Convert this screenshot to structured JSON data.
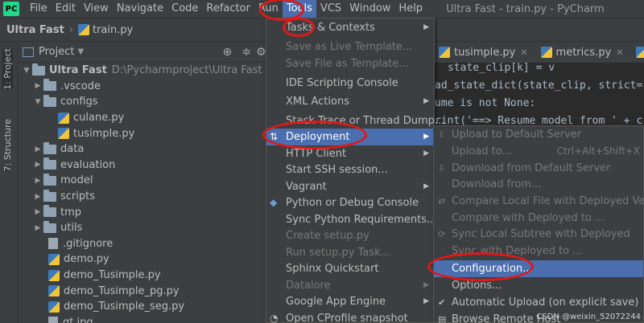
{
  "menubar": {
    "logo": "PC",
    "items": [
      "File",
      "Edit",
      "View",
      "Navigate",
      "Code",
      "Refactor",
      "Run",
      "Tools",
      "VCS",
      "Window",
      "Help"
    ],
    "title": "Ultra Fast - train.py - PyCharm"
  },
  "navbar": {
    "project": "Ultra Fast",
    "file": "train.py"
  },
  "toolstrip": {
    "project_tab": "1: Project",
    "structure_tab": "7: Structure"
  },
  "project": {
    "header": "Project",
    "root": {
      "name": "Ultra Fast",
      "path": "D:\\Pycharmproject\\Ultra Fast"
    },
    "items": [
      ".vscode",
      "configs",
      "culane.py",
      "tusimple.py",
      "data",
      "evaluation",
      "model",
      "scripts",
      "tmp",
      "utils",
      ".gitignore",
      "demo.py",
      "demo_Tusimple.py",
      "demo_Tusimple_pg.py",
      "demo_Tusimple_seg.py",
      "gt.jpg"
    ]
  },
  "editor": {
    "tabs": [
      "tusimple.py",
      "metrics.py",
      "fa"
    ],
    "code": [
      "state_clip[k] = v",
      "ad_state_dict(state_clip, strict=",
      "ume is not None:",
      "rint('==> Resume model from ' + c"
    ]
  },
  "tools_menu": {
    "items": [
      "Tasks & Contexts",
      "Save as Live Template...",
      "Save File as Template...",
      "IDE Scripting Console",
      "XML Actions",
      "Stack Trace or Thread Dump...",
      "Deployment",
      "HTTP Client",
      "Start SSH session...",
      "Vagrant",
      "Python or Debug Console",
      "Sync Python Requirements...",
      "Create setup.py",
      "Run setup.py Task...",
      "Sphinx Quickstart",
      "Datalore",
      "Google App Engine",
      "Open CProfile snapshot"
    ]
  },
  "deployment_menu": {
    "items": [
      "Upload to Default Server",
      "Upload to...",
      "Download from Default Server",
      "Download from...",
      "Compare Local File with Deployed Version",
      "Compare with Deployed to ...",
      "Sync Local Subtree with Deployed",
      "Sync with Deployed to ...",
      "Configuration...",
      "Options...",
      "Automatic Upload (on explicit save)",
      "Browse Remote Host"
    ],
    "upload_to_shortcut": "Ctrl+Alt+Shift+X"
  },
  "watermark": "CSDN @weixin_52072244",
  "colors": {
    "highlight": "#4b6eaf",
    "annotation": "#e01818"
  }
}
